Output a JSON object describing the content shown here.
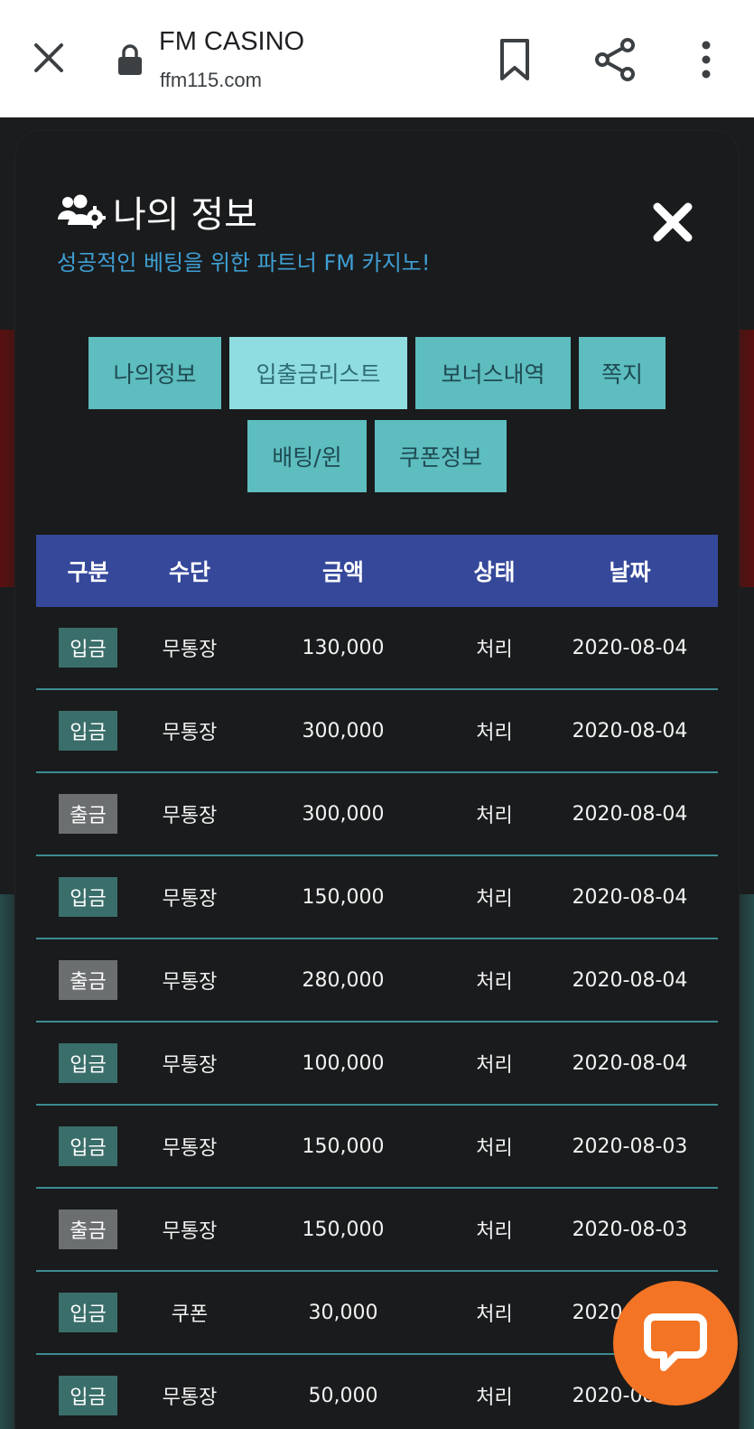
{
  "browser": {
    "title": "FM CASINO",
    "url": "ffm115.com"
  },
  "modal": {
    "title": "나의 정보",
    "subtitle": "성공적인 베팅을 위한 파트너 FM 카지노!"
  },
  "tabs": [
    {
      "label": "나의정보",
      "active": false
    },
    {
      "label": "입출금리스트",
      "active": true
    },
    {
      "label": "보너스내역",
      "active": false
    },
    {
      "label": "쪽지",
      "active": false
    },
    {
      "label": "배팅/윈",
      "active": false
    },
    {
      "label": "쿠폰정보",
      "active": false
    }
  ],
  "table": {
    "headers": [
      "구분",
      "수단",
      "금액",
      "상태",
      "날짜"
    ],
    "rows": [
      {
        "type": "입금",
        "method": "무통장",
        "amount": "130,000",
        "status": "처리",
        "date": "2020-08-04"
      },
      {
        "type": "입금",
        "method": "무통장",
        "amount": "300,000",
        "status": "처리",
        "date": "2020-08-04"
      },
      {
        "type": "출금",
        "method": "무통장",
        "amount": "300,000",
        "status": "처리",
        "date": "2020-08-04"
      },
      {
        "type": "입금",
        "method": "무통장",
        "amount": "150,000",
        "status": "처리",
        "date": "2020-08-04"
      },
      {
        "type": "출금",
        "method": "무통장",
        "amount": "280,000",
        "status": "처리",
        "date": "2020-08-04"
      },
      {
        "type": "입금",
        "method": "무통장",
        "amount": "100,000",
        "status": "처리",
        "date": "2020-08-04"
      },
      {
        "type": "입금",
        "method": "무통장",
        "amount": "150,000",
        "status": "처리",
        "date": "2020-08-03"
      },
      {
        "type": "출금",
        "method": "무통장",
        "amount": "150,000",
        "status": "처리",
        "date": "2020-08-03"
      },
      {
        "type": "입금",
        "method": "쿠폰",
        "amount": "30,000",
        "status": "처리",
        "date": "2020-08-03"
      },
      {
        "type": "입금",
        "method": "무통장",
        "amount": "50,000",
        "status": "처리",
        "date": "2020-08-03"
      }
    ]
  },
  "colors": {
    "tab": "#5dbdbf",
    "tab_active": "#8fdde0",
    "header": "#35489a",
    "deposit_badge": "#3a6e6a",
    "withdraw_badge": "#6b6f70",
    "row_divider": "#3c8c92",
    "chat": "#f27424",
    "subtitle": "#3f9fd4"
  },
  "icons": {
    "browser_close": "close-icon",
    "lock": "lock-icon",
    "bookmark": "bookmark-icon",
    "share": "share-icon",
    "more": "more-vert-icon",
    "users": "users-gear-icon",
    "modal_close": "close-icon",
    "chat": "chat-bubble-icon"
  }
}
